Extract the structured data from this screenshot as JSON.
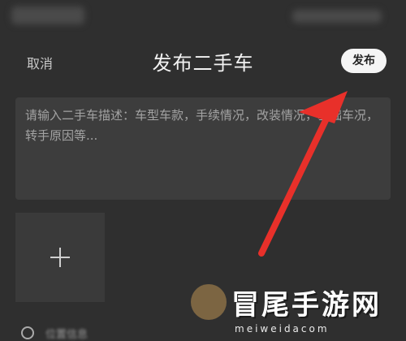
{
  "nav": {
    "cancel_label": "取消",
    "title": "发布二手车",
    "publish_label": "发布"
  },
  "description": {
    "placeholder": "请输入二手车描述：车型车款，手续情况，改装情况，基础车况，转手原因等..."
  },
  "media": {
    "add_icon": "plus-icon"
  },
  "watermark": {
    "text": "冒尾手游网",
    "url": "meiweidacom"
  },
  "bottom": {
    "icon": "location-icon",
    "text": "位置信息"
  },
  "colors": {
    "background": "#2f2f2f",
    "input_background": "#3d3d3d",
    "publish_button": "#f5f5f5",
    "arrow": "#e8302a"
  }
}
